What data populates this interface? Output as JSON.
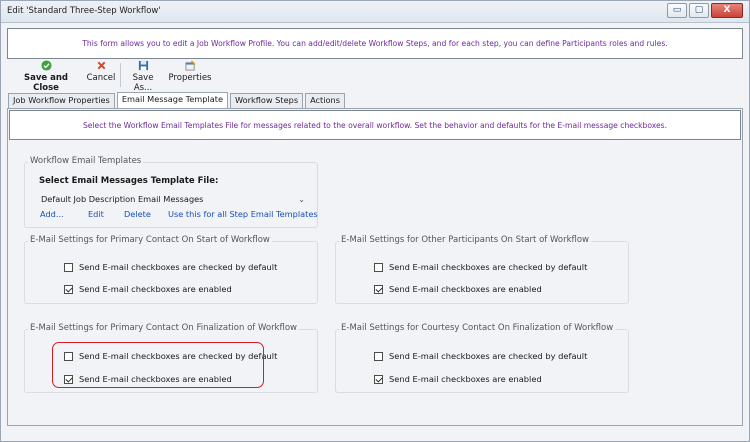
{
  "window": {
    "title": "Edit 'Standard Three-Step Workflow'",
    "controls": {
      "minimize": "▭",
      "maximize": "▢",
      "close": "X"
    }
  },
  "banner": {
    "text": "This form allows you to edit a Job Workflow Profile. You can add/edit/delete Workflow Steps, and for each step, you can define Participants roles and rules."
  },
  "toolbar": {
    "save_close": "Save and Close",
    "cancel": "Cancel",
    "save_as": "Save As...",
    "properties": "Properties"
  },
  "tabs": [
    {
      "label": "Job Workflow Properties",
      "active": false
    },
    {
      "label": "Email Message Template",
      "active": true
    },
    {
      "label": "Workflow Steps",
      "active": false
    },
    {
      "label": "Actions",
      "active": false
    }
  ],
  "email_tab": {
    "description": "Select the Workflow Email Templates File for messages related to the overall workflow. Set the behavior and defaults for the E-mail message checkboxes.",
    "templates_group": {
      "title": "Workflow Email Templates",
      "select_label": "Select Email Messages Template File:",
      "selected_value": "Default Job Description Email Messages",
      "links": {
        "add": "Add...",
        "edit": "Edit",
        "delete": "Delete",
        "use_for_all": "Use this for all Step Email Templates"
      }
    },
    "groups": {
      "primary_start": {
        "title": "E-Mail Settings for Primary Contact On Start of Workflow",
        "checked_default": {
          "label": "Send E-mail checkboxes are checked by default",
          "checked": false
        },
        "enabled": {
          "label": "Send E-mail checkboxes are enabled",
          "checked": true
        }
      },
      "others_start": {
        "title": "E-Mail Settings for Other Participants On Start of Workflow",
        "checked_default": {
          "label": "Send E-mail checkboxes are checked by default",
          "checked": false
        },
        "enabled": {
          "label": "Send E-mail checkboxes are enabled",
          "checked": true
        }
      },
      "primary_final": {
        "title": "E-Mail Settings for Primary Contact On Finalization of Workflow",
        "checked_default": {
          "label": "Send E-mail checkboxes are checked by default",
          "checked": false
        },
        "enabled": {
          "label": "Send E-mail checkboxes are enabled",
          "checked": true
        }
      },
      "courtesy_final": {
        "title": "E-Mail Settings for Courtesy Contact On Finalization of Workflow",
        "checked_default": {
          "label": "Send E-mail checkboxes are checked by default",
          "checked": false
        },
        "enabled": {
          "label": "Send E-mail checkboxes are enabled",
          "checked": true
        }
      }
    }
  },
  "colors": {
    "info_text": "#6d2a9c",
    "link": "#1d4fb8",
    "highlight": "#d31e2a",
    "save_icon": "#3aa43a",
    "cancel_icon": "#d9452b"
  }
}
